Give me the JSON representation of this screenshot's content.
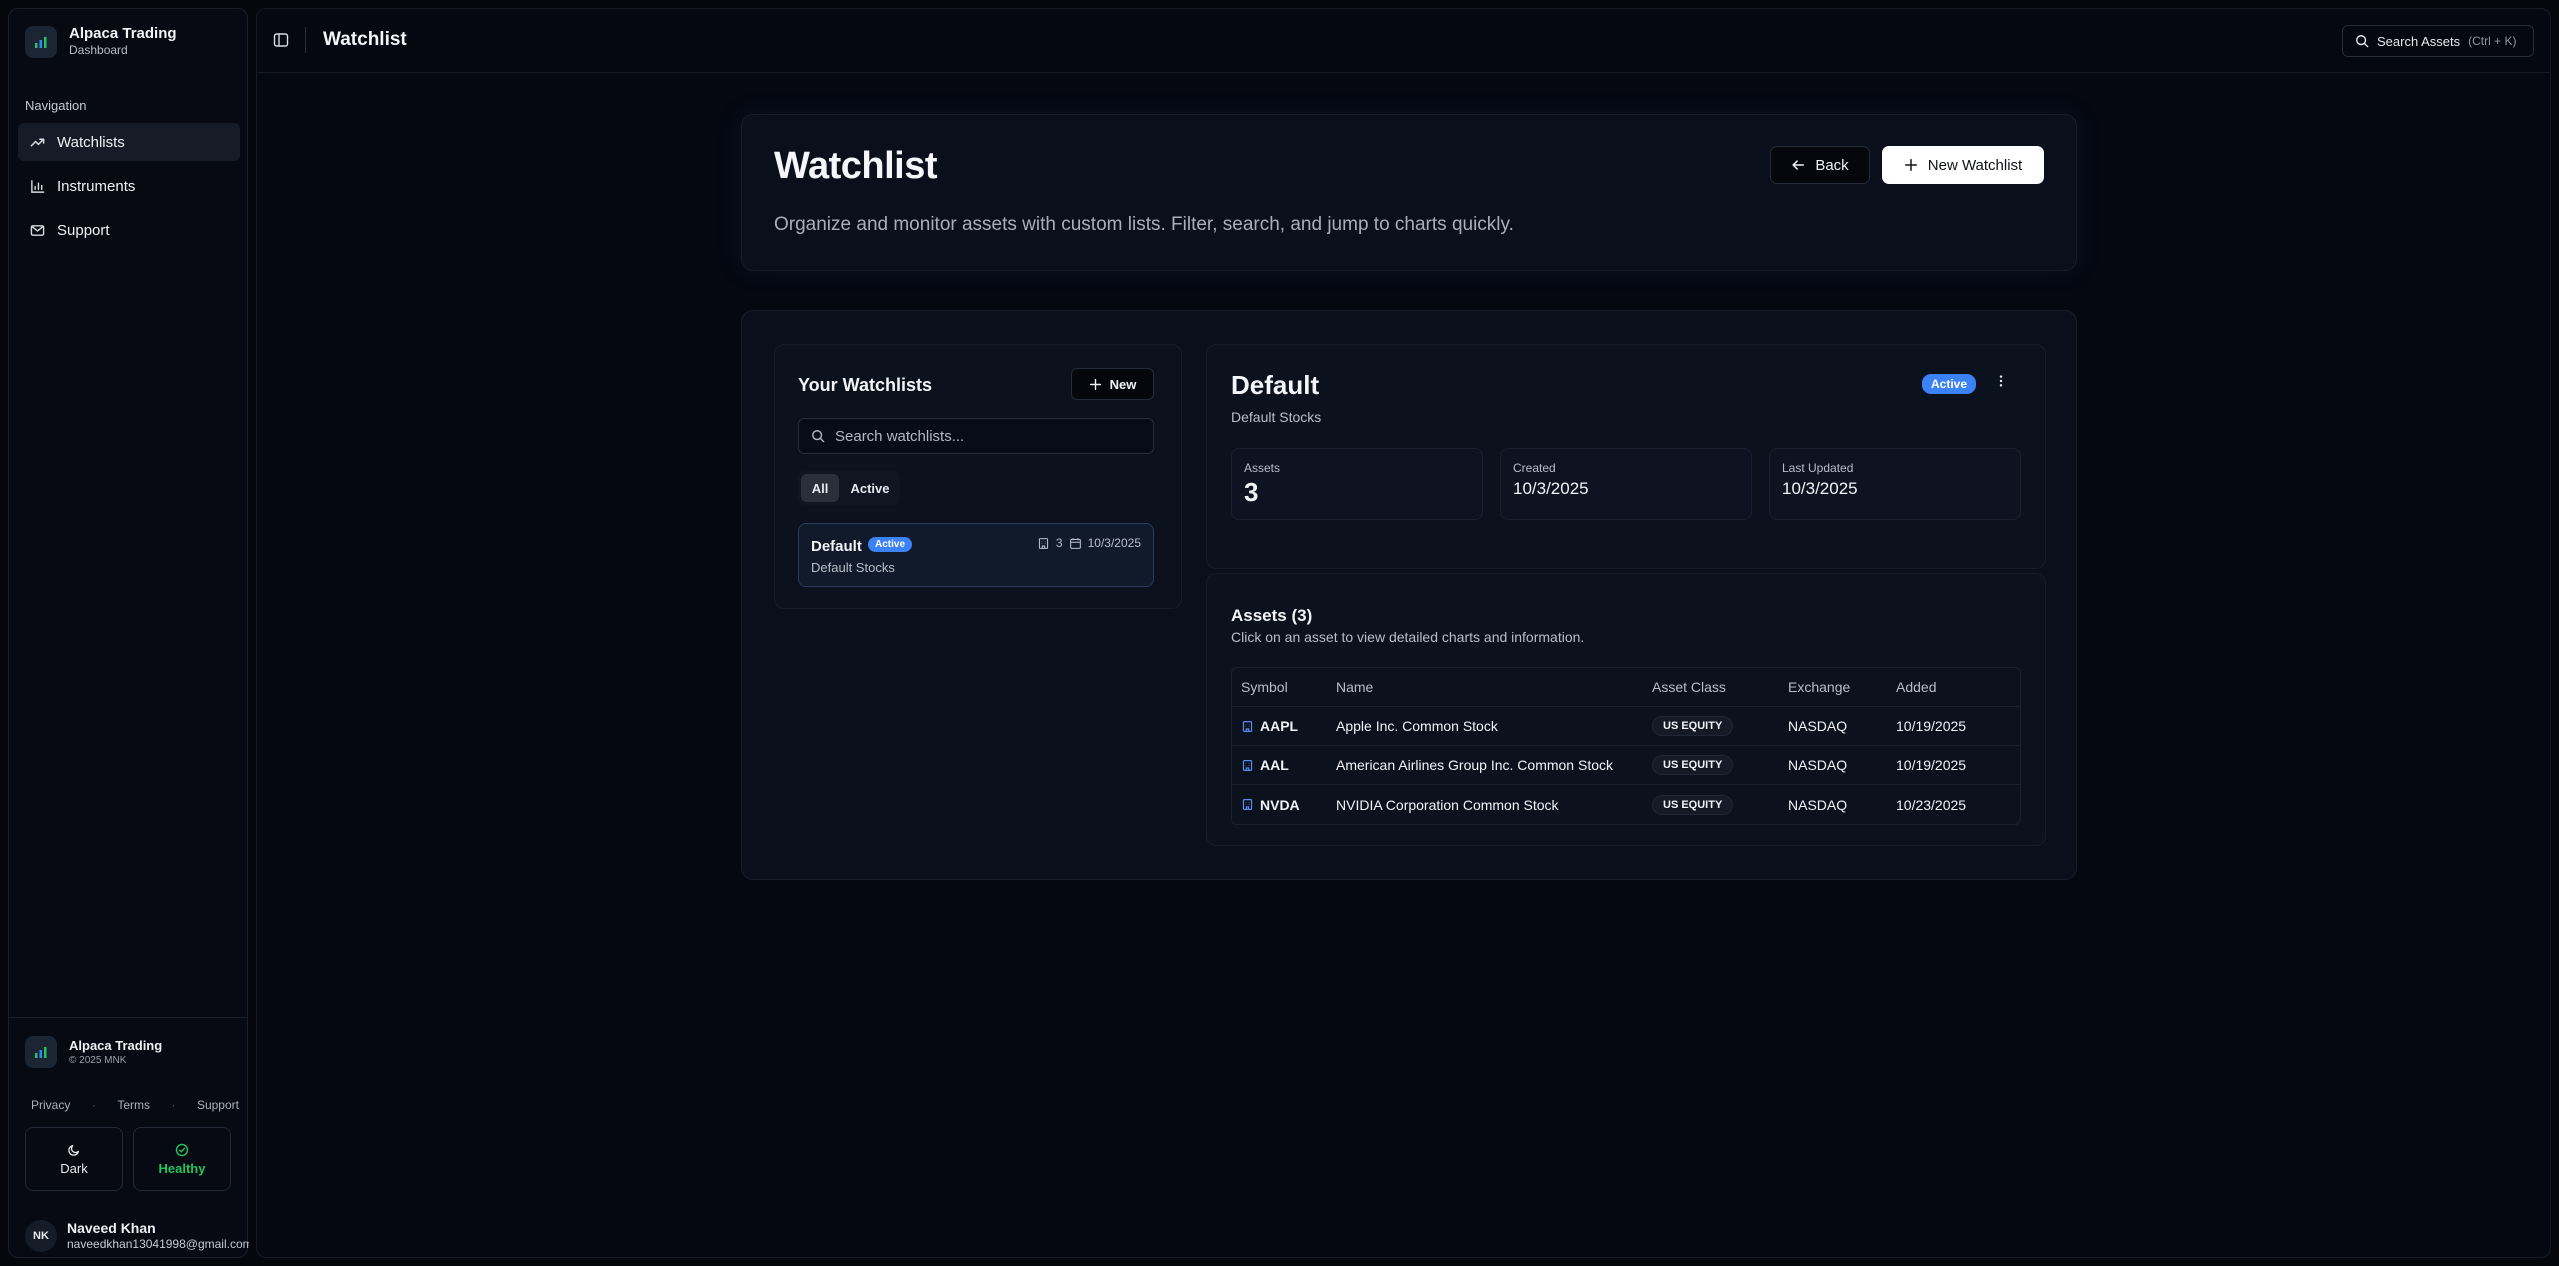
{
  "sidebar": {
    "brand_title": "Alpaca Trading",
    "brand_sub": "Dashboard",
    "nav_label": "Navigation",
    "items": [
      {
        "label": "Watchlists",
        "icon": "trending-up-icon",
        "active": true
      },
      {
        "label": "Instruments",
        "icon": "bar-chart-icon",
        "active": false
      },
      {
        "label": "Support",
        "icon": "mail-icon",
        "active": false
      }
    ],
    "footer": {
      "brand_title": "Alpaca Trading",
      "copyright": "© 2025 MNK",
      "links": [
        "Privacy",
        "Terms",
        "Support"
      ],
      "mode_label": "Dark",
      "health_label": "Healthy",
      "user_initials": "NK",
      "user_name": "Naveed Khan",
      "user_email": "naveedkhan13041998@gmail.com"
    }
  },
  "topbar": {
    "title": "Watchlist",
    "search_label": "Search Assets",
    "search_shortcut": "(Ctrl + K)"
  },
  "hero": {
    "title": "Watchlist",
    "description": "Organize and monitor assets with custom lists. Filter, search, and jump to charts quickly.",
    "back_label": "Back",
    "new_watchlist_label": "New Watchlist"
  },
  "watchlists": {
    "title": "Your Watchlists",
    "new_label": "New",
    "search_placeholder": "Search watchlists...",
    "filters": [
      "All",
      "Active"
    ],
    "items": [
      {
        "name": "Default",
        "status": "Active",
        "description": "Default Stocks",
        "count": "3",
        "date": "10/3/2025"
      }
    ]
  },
  "detail": {
    "name": "Default",
    "description": "Default Stocks",
    "status": "Active",
    "stats": [
      {
        "label": "Assets",
        "value": "3"
      },
      {
        "label": "Created",
        "value": "10/3/2025"
      },
      {
        "label": "Last Updated",
        "value": "10/3/2025"
      }
    ]
  },
  "assets": {
    "title": "Assets (3)",
    "description": "Click on an asset to view detailed charts and information.",
    "columns": [
      "Symbol",
      "Name",
      "Asset Class",
      "Exchange",
      "Added"
    ],
    "rows": [
      {
        "symbol": "AAPL",
        "name": "Apple Inc. Common Stock",
        "class": "US EQUITY",
        "exchange": "NASDAQ",
        "added": "10/19/2025"
      },
      {
        "symbol": "AAL",
        "name": "American Airlines Group Inc. Common Stock",
        "class": "US EQUITY",
        "exchange": "NASDAQ",
        "added": "10/19/2025"
      },
      {
        "symbol": "NVDA",
        "name": "NVIDIA Corporation Common Stock",
        "class": "US EQUITY",
        "exchange": "NASDAQ",
        "added": "10/23/2025"
      }
    ]
  },
  "colors": {
    "accent": "#3b82f6",
    "healthy": "#22c55e",
    "background": "#05070d",
    "card": "#0a0f1b"
  }
}
